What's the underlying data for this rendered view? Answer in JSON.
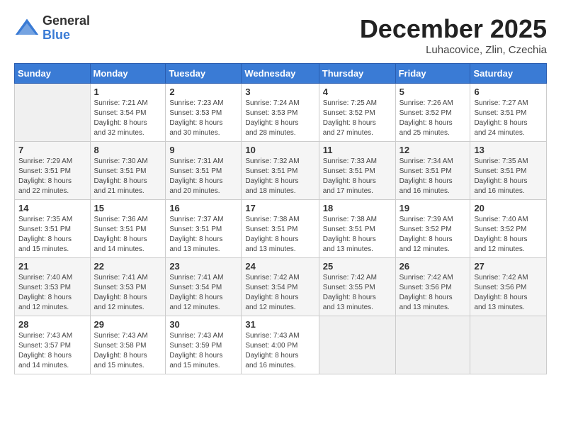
{
  "header": {
    "logo_general": "General",
    "logo_blue": "Blue",
    "month_title": "December 2025",
    "location": "Luhacovice, Zlin, Czechia"
  },
  "days_of_week": [
    "Sunday",
    "Monday",
    "Tuesday",
    "Wednesday",
    "Thursday",
    "Friday",
    "Saturday"
  ],
  "weeks": [
    [
      {
        "day": "",
        "info": ""
      },
      {
        "day": "1",
        "info": "Sunrise: 7:21 AM\nSunset: 3:54 PM\nDaylight: 8 hours\nand 32 minutes."
      },
      {
        "day": "2",
        "info": "Sunrise: 7:23 AM\nSunset: 3:53 PM\nDaylight: 8 hours\nand 30 minutes."
      },
      {
        "day": "3",
        "info": "Sunrise: 7:24 AM\nSunset: 3:53 PM\nDaylight: 8 hours\nand 28 minutes."
      },
      {
        "day": "4",
        "info": "Sunrise: 7:25 AM\nSunset: 3:52 PM\nDaylight: 8 hours\nand 27 minutes."
      },
      {
        "day": "5",
        "info": "Sunrise: 7:26 AM\nSunset: 3:52 PM\nDaylight: 8 hours\nand 25 minutes."
      },
      {
        "day": "6",
        "info": "Sunrise: 7:27 AM\nSunset: 3:51 PM\nDaylight: 8 hours\nand 24 minutes."
      }
    ],
    [
      {
        "day": "7",
        "info": "Sunrise: 7:29 AM\nSunset: 3:51 PM\nDaylight: 8 hours\nand 22 minutes."
      },
      {
        "day": "8",
        "info": "Sunrise: 7:30 AM\nSunset: 3:51 PM\nDaylight: 8 hours\nand 21 minutes."
      },
      {
        "day": "9",
        "info": "Sunrise: 7:31 AM\nSunset: 3:51 PM\nDaylight: 8 hours\nand 20 minutes."
      },
      {
        "day": "10",
        "info": "Sunrise: 7:32 AM\nSunset: 3:51 PM\nDaylight: 8 hours\nand 18 minutes."
      },
      {
        "day": "11",
        "info": "Sunrise: 7:33 AM\nSunset: 3:51 PM\nDaylight: 8 hours\nand 17 minutes."
      },
      {
        "day": "12",
        "info": "Sunrise: 7:34 AM\nSunset: 3:51 PM\nDaylight: 8 hours\nand 16 minutes."
      },
      {
        "day": "13",
        "info": "Sunrise: 7:35 AM\nSunset: 3:51 PM\nDaylight: 8 hours\nand 16 minutes."
      }
    ],
    [
      {
        "day": "14",
        "info": "Sunrise: 7:35 AM\nSunset: 3:51 PM\nDaylight: 8 hours\nand 15 minutes."
      },
      {
        "day": "15",
        "info": "Sunrise: 7:36 AM\nSunset: 3:51 PM\nDaylight: 8 hours\nand 14 minutes."
      },
      {
        "day": "16",
        "info": "Sunrise: 7:37 AM\nSunset: 3:51 PM\nDaylight: 8 hours\nand 13 minutes."
      },
      {
        "day": "17",
        "info": "Sunrise: 7:38 AM\nSunset: 3:51 PM\nDaylight: 8 hours\nand 13 minutes."
      },
      {
        "day": "18",
        "info": "Sunrise: 7:38 AM\nSunset: 3:51 PM\nDaylight: 8 hours\nand 13 minutes."
      },
      {
        "day": "19",
        "info": "Sunrise: 7:39 AM\nSunset: 3:52 PM\nDaylight: 8 hours\nand 12 minutes."
      },
      {
        "day": "20",
        "info": "Sunrise: 7:40 AM\nSunset: 3:52 PM\nDaylight: 8 hours\nand 12 minutes."
      }
    ],
    [
      {
        "day": "21",
        "info": "Sunrise: 7:40 AM\nSunset: 3:53 PM\nDaylight: 8 hours\nand 12 minutes."
      },
      {
        "day": "22",
        "info": "Sunrise: 7:41 AM\nSunset: 3:53 PM\nDaylight: 8 hours\nand 12 minutes."
      },
      {
        "day": "23",
        "info": "Sunrise: 7:41 AM\nSunset: 3:54 PM\nDaylight: 8 hours\nand 12 minutes."
      },
      {
        "day": "24",
        "info": "Sunrise: 7:42 AM\nSunset: 3:54 PM\nDaylight: 8 hours\nand 12 minutes."
      },
      {
        "day": "25",
        "info": "Sunrise: 7:42 AM\nSunset: 3:55 PM\nDaylight: 8 hours\nand 13 minutes."
      },
      {
        "day": "26",
        "info": "Sunrise: 7:42 AM\nSunset: 3:56 PM\nDaylight: 8 hours\nand 13 minutes."
      },
      {
        "day": "27",
        "info": "Sunrise: 7:42 AM\nSunset: 3:56 PM\nDaylight: 8 hours\nand 13 minutes."
      }
    ],
    [
      {
        "day": "28",
        "info": "Sunrise: 7:43 AM\nSunset: 3:57 PM\nDaylight: 8 hours\nand 14 minutes."
      },
      {
        "day": "29",
        "info": "Sunrise: 7:43 AM\nSunset: 3:58 PM\nDaylight: 8 hours\nand 15 minutes."
      },
      {
        "day": "30",
        "info": "Sunrise: 7:43 AM\nSunset: 3:59 PM\nDaylight: 8 hours\nand 15 minutes."
      },
      {
        "day": "31",
        "info": "Sunrise: 7:43 AM\nSunset: 4:00 PM\nDaylight: 8 hours\nand 16 minutes."
      },
      {
        "day": "",
        "info": ""
      },
      {
        "day": "",
        "info": ""
      },
      {
        "day": "",
        "info": ""
      }
    ]
  ]
}
